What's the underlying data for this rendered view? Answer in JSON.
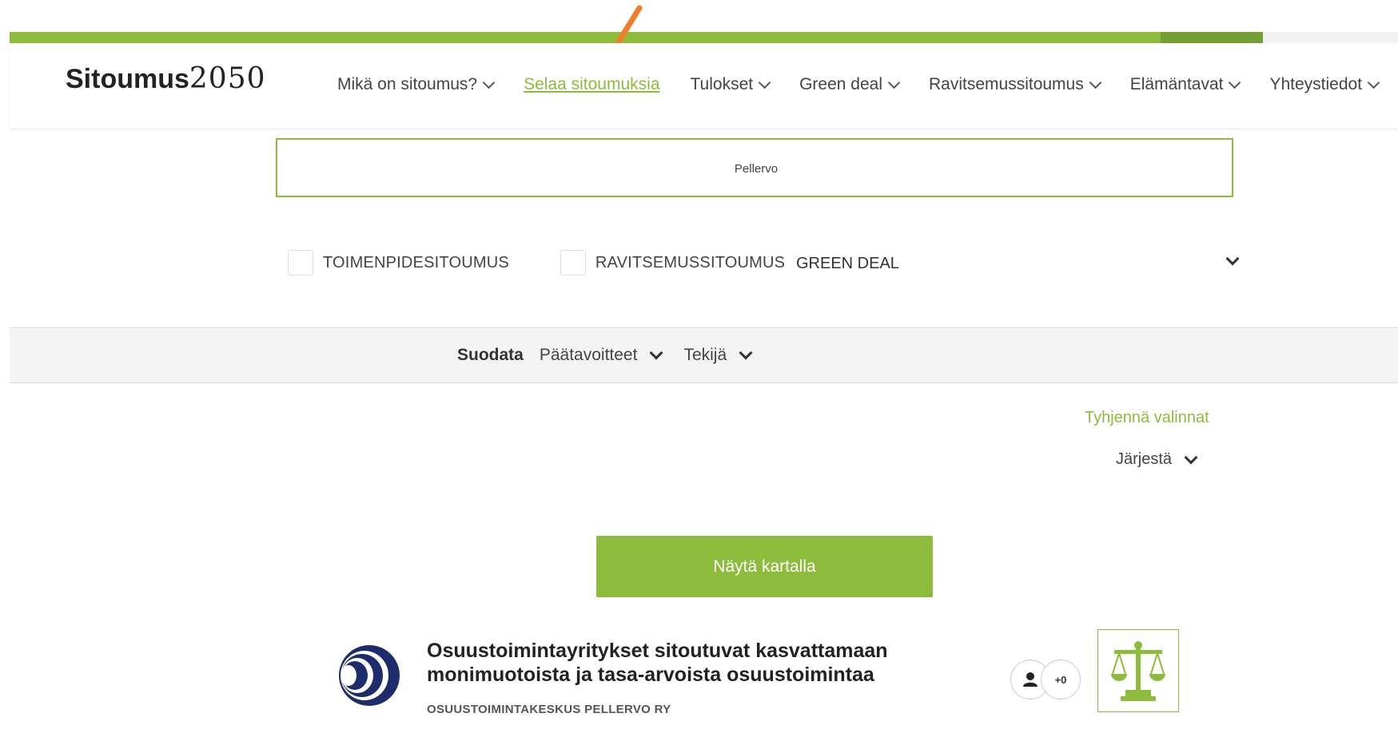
{
  "logo": {
    "bold": "Sitoumus",
    "number": "2050"
  },
  "nav": {
    "items": [
      {
        "label": "Mikä on sitoumus?",
        "dropdown": true
      },
      {
        "label": "Selaa sitoumuksia",
        "dropdown": false,
        "active": true
      },
      {
        "label": "Tulokset",
        "dropdown": true
      },
      {
        "label": "Green deal",
        "dropdown": true
      },
      {
        "label": "Ravitsemussitoumus",
        "dropdown": true
      },
      {
        "label": "Elämäntavat",
        "dropdown": true
      },
      {
        "label": "Yhteystiedot",
        "dropdown": true
      }
    ]
  },
  "search": {
    "value": "Pellervo"
  },
  "types": {
    "toimenpide": "TOIMENPIDESITOUMUS",
    "ravitsemus": "RAVITSEMUSSITOUMUS",
    "green_deal": "GREEN DEAL"
  },
  "filter": {
    "title": "Suodata",
    "goals": "Päätavoitteet",
    "author": "Tekijä"
  },
  "actions": {
    "clear": "Tyhjennä valinnat",
    "sort": "Järjestä",
    "map_button": "Näytä kartalla"
  },
  "result": {
    "title": "Osuustoimintayritykset sitoutuvat kasvattamaan monimuotoista ja tasa-arvoista osuustoimintaa",
    "org": "OSUUSTOIMINTAKESKUS PELLERVO RY",
    "participant_count": "+0"
  },
  "colors": {
    "accent": "#8dbb3c",
    "arrow": "#f07f2c",
    "logo_blue": "#1d2d6b"
  }
}
